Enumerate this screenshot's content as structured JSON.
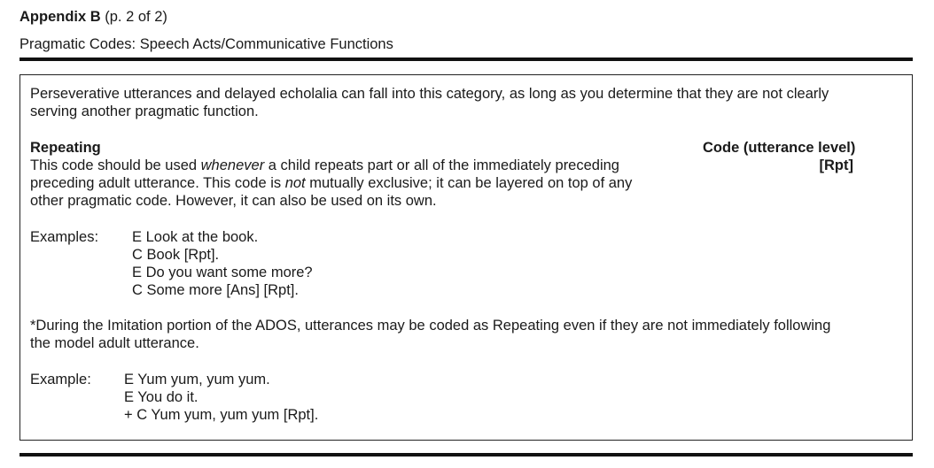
{
  "header": {
    "appendix_label": "Appendix B",
    "page_indicator": "(p. 2 of 2)",
    "subtitle": "Pragmatic Codes: Speech Acts/Communicative Functions"
  },
  "body": {
    "intro_line_1": "Perseverative utterances and delayed echolalia can fall into this category, as long as you determine that they are not clearly",
    "intro_line_2": "serving another pragmatic function.",
    "section_heading": "Repeating",
    "code_heading": "Code (utterance level)",
    "code_value": "[Rpt]",
    "def_line_1_a": "This code should be used ",
    "def_line_1_em": "whenever",
    "def_line_1_b": " a child repeats part or all of the immediately preceding",
    "def_line_2_a": "preceding adult utterance. This code is ",
    "def_line_2_em": "not",
    "def_line_2_b": " mutually exclusive; it can be layered on top of any",
    "def_line_3": "other pragmatic code. However, it can also be used on its own.",
    "examples_label": "Examples:",
    "examples": [
      "E Look at the book.",
      "C Book [Rpt].",
      "E Do you want some more?",
      "C Some more [Ans] [Rpt]."
    ],
    "note_line_1": "*During the Imitation portion of the ADOS, utterances may be coded as Repeating even if they are not immediately following",
    "note_line_2": "the model adult utterance.",
    "example_label": "Example:",
    "example_lines": [
      "E Yum yum, yum yum.",
      "E You do it.",
      "+ C Yum yum, yum yum [Rpt]."
    ]
  }
}
